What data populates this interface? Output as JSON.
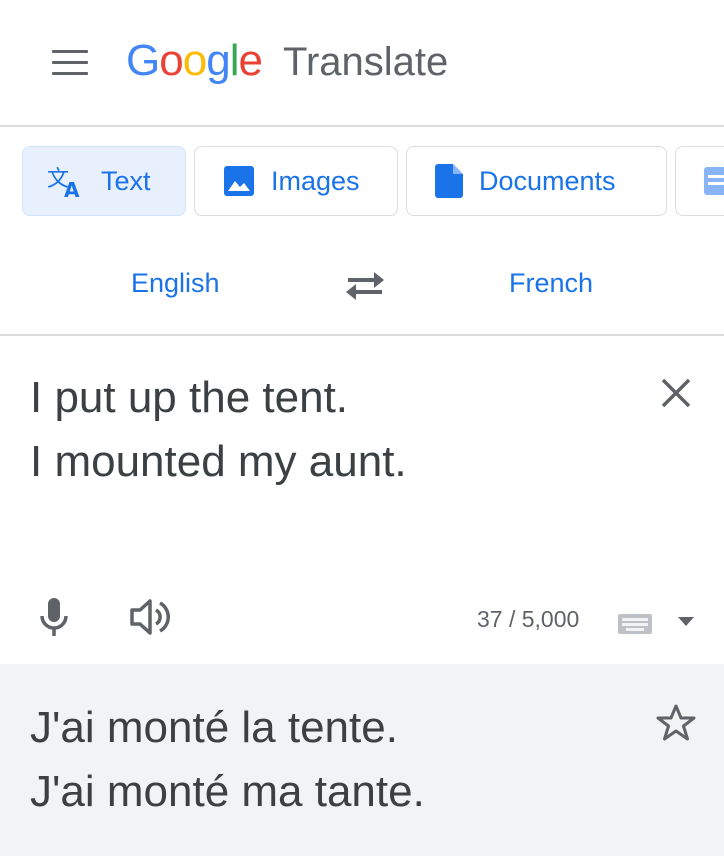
{
  "header": {
    "menu_icon": "hamburger-menu-icon",
    "logo": [
      "G",
      "o",
      "o",
      "g",
      "l",
      "e"
    ],
    "product": "Translate"
  },
  "modes": [
    {
      "label": "Text",
      "icon": "translate-icon",
      "active": true
    },
    {
      "label": "Images",
      "icon": "image-icon",
      "active": false
    },
    {
      "label": "Documents",
      "icon": "document-icon",
      "active": false
    }
  ],
  "languages": {
    "source": "English",
    "target": "French",
    "swap_icon": "swap-arrows-icon"
  },
  "source": {
    "lines": [
      "I put up the tent.",
      "I mounted my aunt."
    ],
    "char_count": "37 / 5,000"
  },
  "translation": {
    "lines": [
      "J'ai monté la tente.",
      "J'ai monté ma tante."
    ]
  },
  "colors": {
    "accent": "#1a73e8",
    "active_chip_bg": "#e8f0fe",
    "output_bg": "#f1f3f4",
    "text": "#3c4043"
  }
}
